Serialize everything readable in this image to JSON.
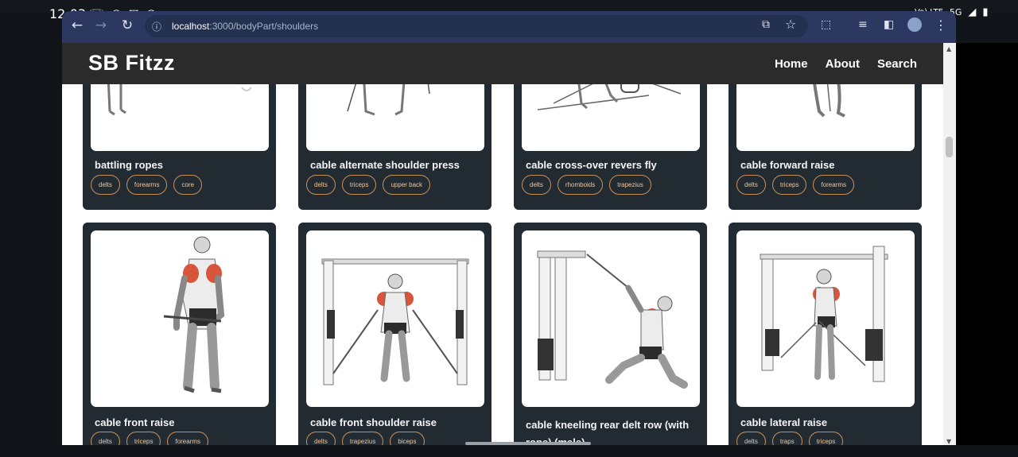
{
  "status": {
    "time": "12:03",
    "icons": [
      "missed-call-icon",
      "whatsapp-icon",
      "gmail-icon",
      "instagram-icon",
      "dot-icon"
    ],
    "network_label": "Vo) LTE",
    "network_type": "5G"
  },
  "browser": {
    "url_host": "localhost",
    "url_path": ":3000/bodyPart/shoulders",
    "back_symbol": "←",
    "forward_symbol": "→",
    "reload_symbol": "↻",
    "more_symbol": "⋮"
  },
  "site": {
    "logo": "SB Fitzz",
    "nav": [
      "Home",
      "About",
      "Search"
    ]
  },
  "cards": [
    {
      "title": "battling ropes",
      "tags": [
        "delts",
        "forearms",
        "core"
      ]
    },
    {
      "title": "cable alternate shoulder press",
      "tags": [
        "delts",
        "triceps",
        "upper back"
      ]
    },
    {
      "title": "cable cross-over revers fly",
      "tags": [
        "delts",
        "rhomboids",
        "trapezius"
      ]
    },
    {
      "title": "cable forward raise",
      "tags": [
        "delts",
        "triceps",
        "forearms"
      ]
    },
    {
      "title": "cable front raise",
      "tags": [
        "delts",
        "triceps",
        "forearms"
      ]
    },
    {
      "title": "cable front shoulder raise",
      "tags": [
        "delts",
        "trapezius",
        "biceps"
      ]
    },
    {
      "title": "cable kneeling rear delt row (with rope) (male)",
      "tags": []
    },
    {
      "title": "cable lateral raise",
      "tags": [
        "delts",
        "traps",
        "triceps"
      ]
    }
  ],
  "colors": {
    "header_bg": "#2b2b2b",
    "card_bg": "#222a32",
    "tag_border": "#c8915a",
    "muscle_highlight": "#d8553b"
  }
}
